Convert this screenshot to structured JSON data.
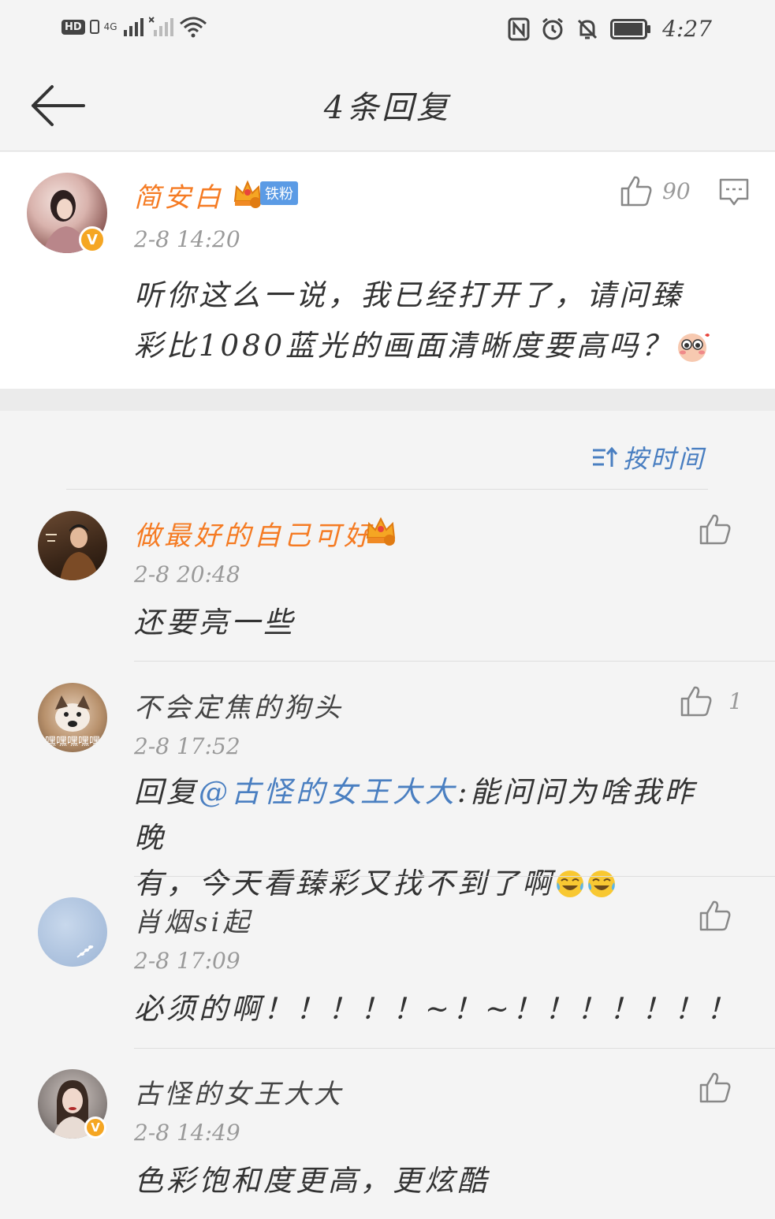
{
  "status_bar": {
    "hd": "HD",
    "network": "4G",
    "time": "4:27"
  },
  "header": {
    "title": "4条回复"
  },
  "main_comment": {
    "username": "简安白",
    "fan_badge": "铁粉",
    "crown_level": "5",
    "timestamp": "2-8 14:20",
    "like_count": "90",
    "text_line1": "听你这么一说，我已经打开了，请问臻",
    "text_line2": "彩比1080蓝光的画面清晰度要高吗？"
  },
  "sort": {
    "label": "按时间"
  },
  "replies": [
    {
      "username": "做最好的自己可好",
      "crown_level": "3",
      "timestamp": "2-8 20:48",
      "text": "还要亮一些",
      "like_count": ""
    },
    {
      "username": "不会定焦的狗头",
      "timestamp": "2-8 17:52",
      "text_prefix": "回复",
      "mention": "@古怪的女王大大",
      "text_after_mention": ":能问问为啥我昨晚",
      "text_line2": "有，今天看臻彩又找不到了啊",
      "like_count": "1",
      "avatar_overlay": "嘿嘿嘿嘿嘿"
    },
    {
      "username": "肖烟si起",
      "timestamp": "2-8 17:09",
      "text": "必须的啊！！！！！~！~！！！！！！！",
      "like_count": ""
    },
    {
      "username": "古怪的女王大大",
      "timestamp": "2-8 14:49",
      "text": "色彩饱和度更高，更炫酷",
      "like_count": ""
    }
  ],
  "colors": {
    "accent_orange": "#f57b23",
    "link_blue": "#4a7fc1",
    "verified_gold": "#f5a623"
  }
}
